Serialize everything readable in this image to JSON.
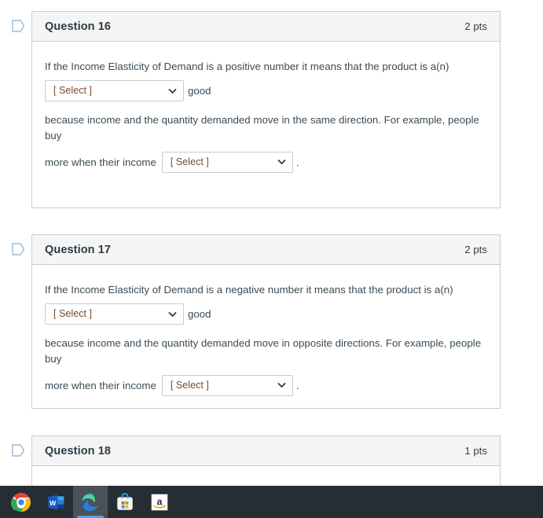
{
  "page": {
    "background": "#ffffff",
    "card_border_color": "#c7cdd1",
    "header_background": "#f5f5f5",
    "text_color": "#3b4b56",
    "select_text_color": "#7a4a2e"
  },
  "questions": [
    {
      "flag_icon": "flag-outline-icon",
      "title": "Question 16",
      "points": "2 pts",
      "line1": "If the Income Elasticity of Demand is a positive number it means that the product is a(n)",
      "select1": "[ Select ]",
      "after_select1": "good",
      "line2": "because income and the quantity demanded move in the same direction. For example, people buy",
      "line3_prefix": "more when their income",
      "select2": "[ Select ]",
      "line3_suffix": "."
    },
    {
      "flag_icon": "flag-outline-icon",
      "title": "Question 17",
      "points": "2 pts",
      "line1": "If the Income Elasticity of Demand is a negative number it means that the product is a(n)",
      "select1": "[ Select ]",
      "after_select1": "good",
      "line2": "because income and the quantity demanded move in opposite directions. For example, people buy",
      "line3_prefix": "more when their income",
      "select2": "[ Select ]",
      "line3_suffix": "."
    },
    {
      "flag_icon": "flag-outline-icon",
      "title": "Question 18",
      "points": "1 pts"
    }
  ],
  "taskbar": {
    "background": "#262d33",
    "active_indicator_color": "#4aa3e8",
    "items": [
      {
        "name": "chrome",
        "label": "Google Chrome",
        "active": false
      },
      {
        "name": "word",
        "label": "Microsoft Word",
        "active": false
      },
      {
        "name": "edge",
        "label": "Microsoft Edge",
        "active": true
      },
      {
        "name": "store",
        "label": "Microsoft Store",
        "active": false
      },
      {
        "name": "amazon",
        "label": "Amazon",
        "active": false
      }
    ]
  }
}
